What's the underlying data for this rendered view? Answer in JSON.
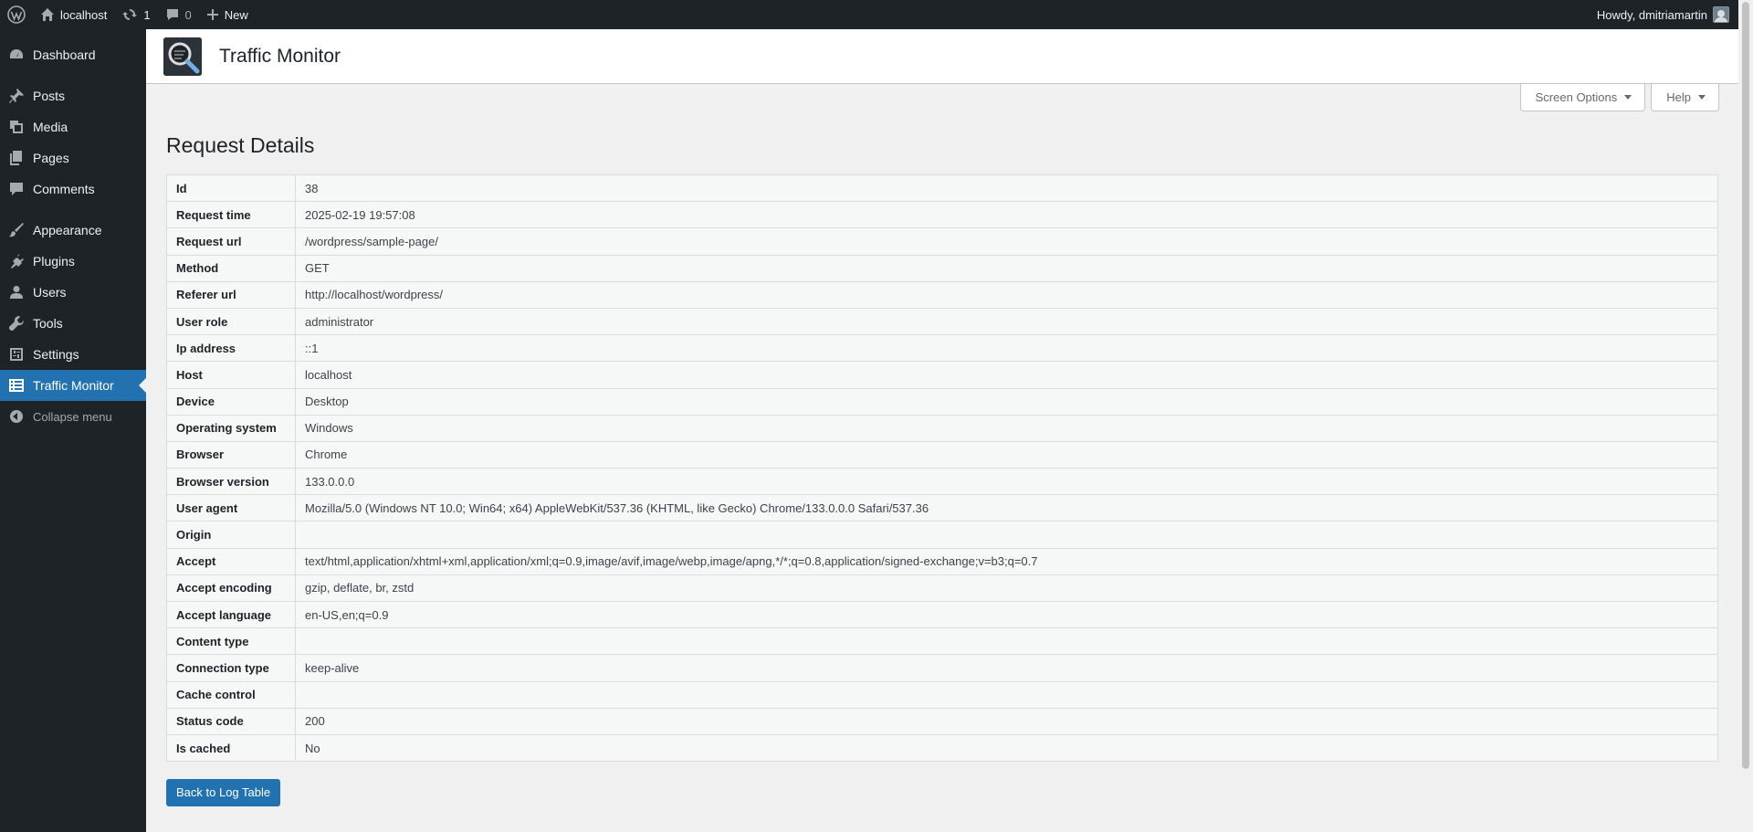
{
  "adminbar": {
    "site_name": "localhost",
    "updates_count": "1",
    "comments_count": "0",
    "new_label": "New",
    "howdy": "Howdy, dmitriamartin"
  },
  "sidebar": {
    "items": [
      {
        "label": "Dashboard",
        "icon": "dashboard-icon"
      },
      {
        "label": "Posts",
        "icon": "pushpin-icon"
      },
      {
        "label": "Media",
        "icon": "media-icon"
      },
      {
        "label": "Pages",
        "icon": "pages-icon"
      },
      {
        "label": "Comments",
        "icon": "comment-icon"
      },
      {
        "label": "Appearance",
        "icon": "paintbrush-icon"
      },
      {
        "label": "Plugins",
        "icon": "plugin-icon"
      },
      {
        "label": "Users",
        "icon": "user-icon"
      },
      {
        "label": "Tools",
        "icon": "wrench-icon"
      },
      {
        "label": "Settings",
        "icon": "settings-icon"
      },
      {
        "label": "Traffic Monitor",
        "icon": "list-icon"
      }
    ],
    "collapse_label": "Collapse menu"
  },
  "header": {
    "title": "Traffic Monitor"
  },
  "screen_options_label": "Screen Options",
  "help_label": "Help",
  "page_title": "Request Details",
  "details": [
    {
      "key": "Id",
      "value": "38"
    },
    {
      "key": "Request time",
      "value": "2025-02-19 19:57:08"
    },
    {
      "key": "Request url",
      "value": "/wordpress/sample-page/"
    },
    {
      "key": "Method",
      "value": "GET"
    },
    {
      "key": "Referer url",
      "value": "http://localhost/wordpress/"
    },
    {
      "key": "User role",
      "value": "administrator"
    },
    {
      "key": "Ip address",
      "value": "::1"
    },
    {
      "key": "Host",
      "value": "localhost"
    },
    {
      "key": "Device",
      "value": "Desktop"
    },
    {
      "key": "Operating system",
      "value": "Windows"
    },
    {
      "key": "Browser",
      "value": "Chrome"
    },
    {
      "key": "Browser version",
      "value": "133.0.0.0"
    },
    {
      "key": "User agent",
      "value": "Mozilla/5.0 (Windows NT 10.0; Win64; x64) AppleWebKit/537.36 (KHTML, like Gecko) Chrome/133.0.0.0 Safari/537.36"
    },
    {
      "key": "Origin",
      "value": ""
    },
    {
      "key": "Accept",
      "value": "text/html,application/xhtml+xml,application/xml;q=0.9,image/avif,image/webp,image/apng,*/*;q=0.8,application/signed-exchange;v=b3;q=0.7"
    },
    {
      "key": "Accept encoding",
      "value": "gzip, deflate, br, zstd"
    },
    {
      "key": "Accept language",
      "value": "en-US,en;q=0.9"
    },
    {
      "key": "Content type",
      "value": ""
    },
    {
      "key": "Connection type",
      "value": "keep-alive"
    },
    {
      "key": "Cache control",
      "value": ""
    },
    {
      "key": "Status code",
      "value": "200"
    },
    {
      "key": "Is cached",
      "value": "No"
    }
  ],
  "back_button_label": "Back to Log Table",
  "colors": {
    "admin_dark": "#1d2327",
    "accent": "#2271b1",
    "background": "#f0f0f1"
  }
}
